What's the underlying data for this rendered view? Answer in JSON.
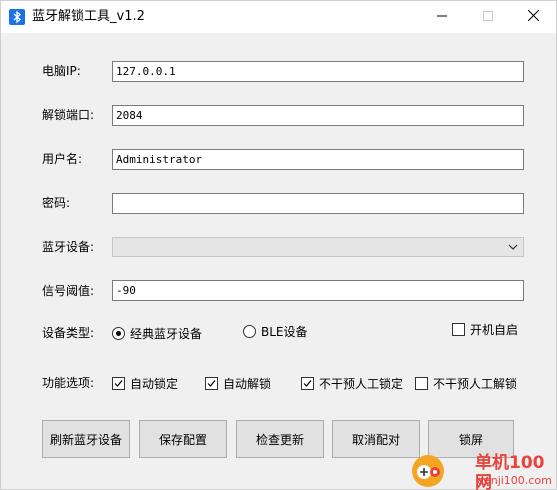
{
  "window": {
    "title": "蓝牙解锁工具_v1.2"
  },
  "fields": {
    "ip": {
      "label": "电脑IP:",
      "value": "127.0.0.1"
    },
    "port": {
      "label": "解锁端口:",
      "value": "2084"
    },
    "username": {
      "label": "用户名:",
      "value": "Administrator"
    },
    "password": {
      "label": "密码:",
      "value": ""
    },
    "device": {
      "label": "蓝牙设备:",
      "value": ""
    },
    "threshold": {
      "label": "信号阈值:",
      "value": "-90"
    }
  },
  "device_type": {
    "label": "设备类型:",
    "options": [
      {
        "label": "经典蓝牙设备",
        "selected": true
      },
      {
        "label": "BLE设备",
        "selected": false
      }
    ],
    "autostart": {
      "label": "开机自启",
      "checked": false
    }
  },
  "features": {
    "label": "功能选项:",
    "items": [
      {
        "label": "自动锁定",
        "checked": true
      },
      {
        "label": "自动解锁",
        "checked": true
      },
      {
        "label": "不干预人工锁定",
        "checked": true
      },
      {
        "label": "不干预人工解锁",
        "checked": false
      }
    ]
  },
  "buttons": {
    "refresh": "刷新蓝牙设备",
    "save": "保存配置",
    "update": "检查更新",
    "unpair": "取消配对",
    "lock": "锁屏"
  },
  "watermark": {
    "name": "单机100网",
    "domain": "danji100.com"
  },
  "colors": {
    "window_bg": "#f0f0f0",
    "accent": "#1a73e8",
    "watermark": "#e8433d"
  },
  "icons": {
    "app": "bluetooth-icon",
    "minimize": "minimize-icon",
    "maximize": "maximize-icon",
    "close": "close-icon",
    "dropdown": "chevron-down-icon"
  }
}
